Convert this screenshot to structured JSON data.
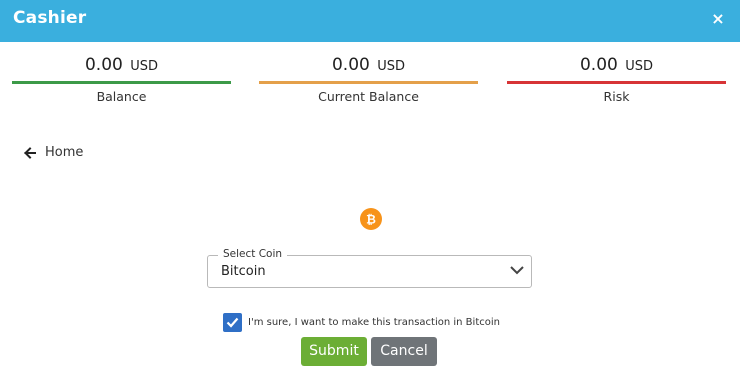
{
  "header": {
    "title": "Cashier",
    "close_symbol": "×",
    "background": "#3aafde"
  },
  "balances": [
    {
      "amount": "0.00",
      "currency": "USD",
      "label": "Balance",
      "color": "#3c9a48"
    },
    {
      "amount": "0.00",
      "currency": "USD",
      "label": "Current Balance",
      "color": "#e4a04a"
    },
    {
      "amount": "0.00",
      "currency": "USD",
      "label": "Risk",
      "color": "#d73436"
    }
  ],
  "nav": {
    "home_label": "Home",
    "icon": "arrow-left-icon"
  },
  "coin": {
    "icon": "bitcoin-icon",
    "color": "#f7931a"
  },
  "coin_select": {
    "legend": "Select Coin",
    "value": "Bitcoin"
  },
  "confirm": {
    "checked": true,
    "label": "I'm sure, I want to make this transaction in Bitcoin"
  },
  "actions": {
    "submit_label": "Submit",
    "cancel_label": "Cancel"
  }
}
